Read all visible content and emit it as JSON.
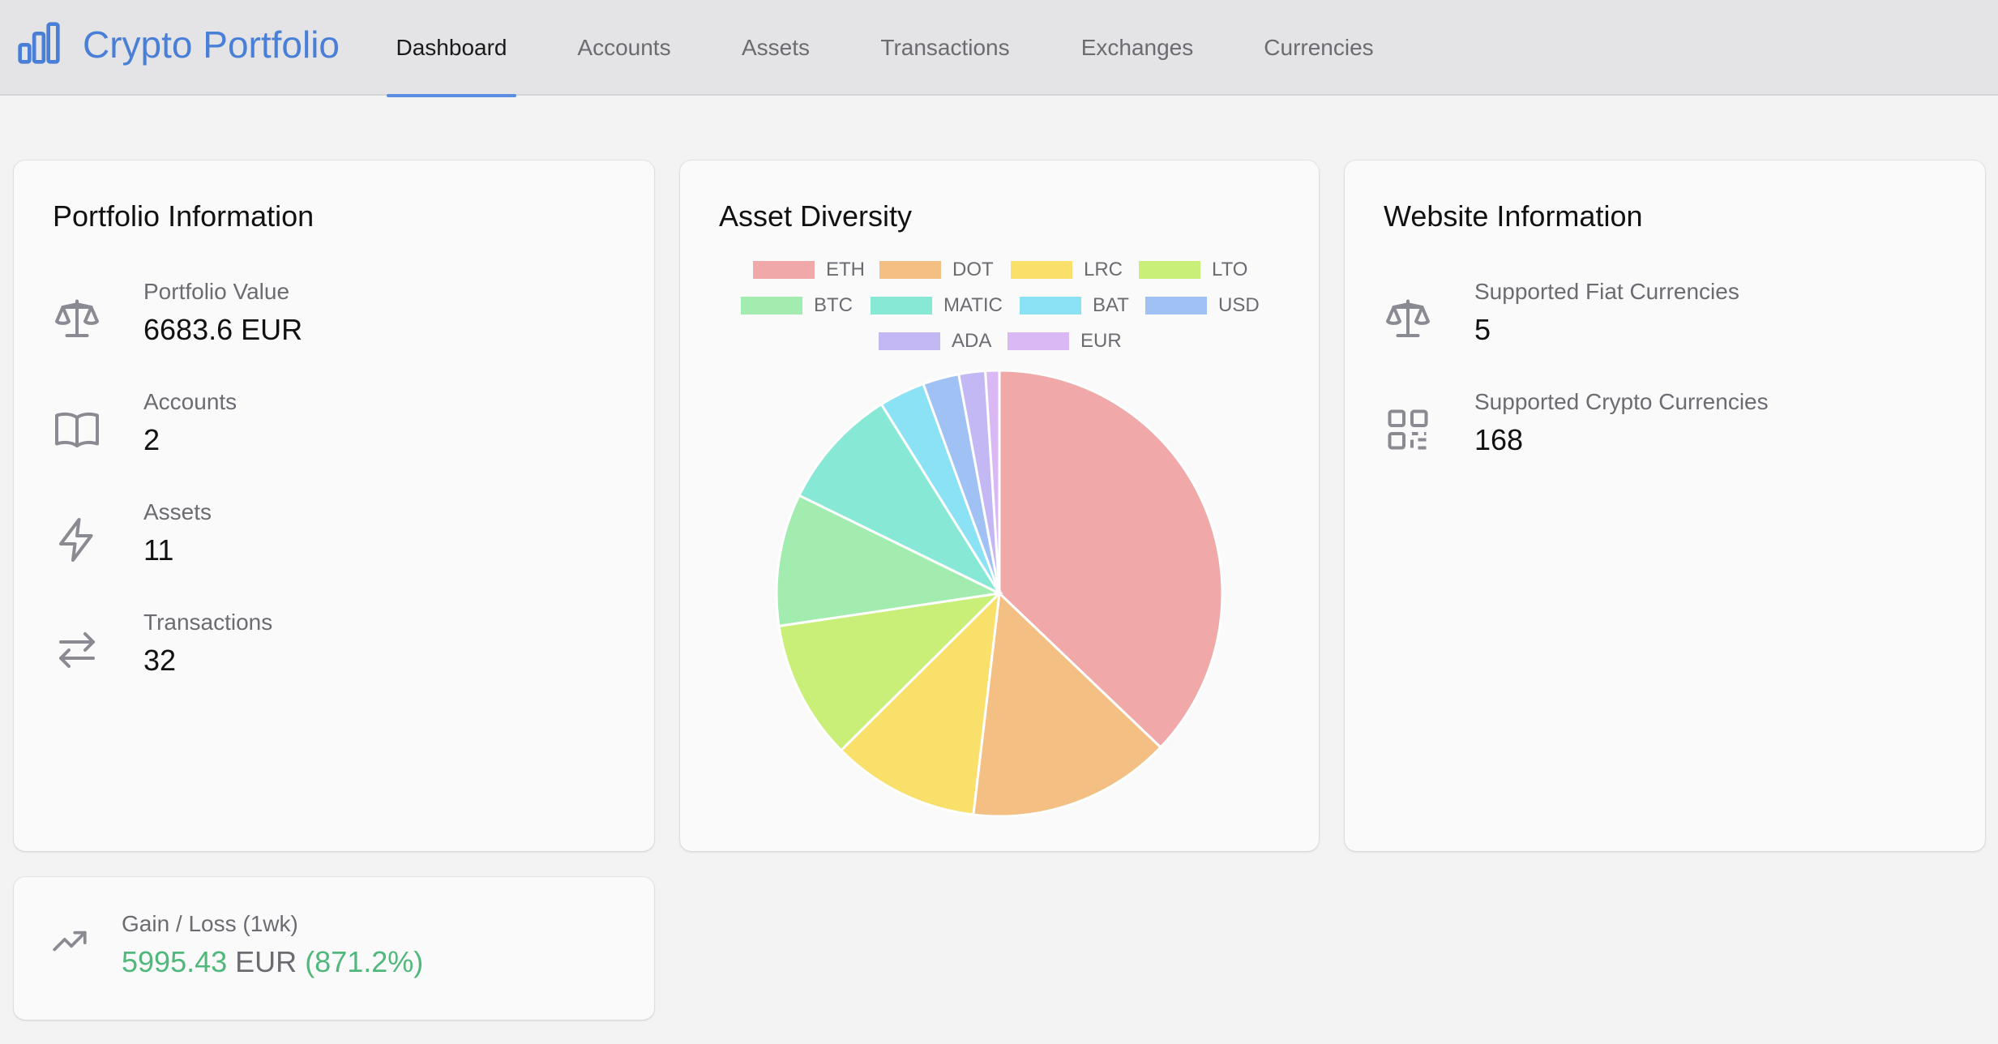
{
  "app": {
    "title": "Crypto Portfolio",
    "brand_color": "#4a7fd8",
    "logo_icon": "bar-chart-icon"
  },
  "nav": {
    "tabs": [
      {
        "label": "Dashboard",
        "active": true
      },
      {
        "label": "Accounts",
        "active": false
      },
      {
        "label": "Assets",
        "active": false
      },
      {
        "label": "Transactions",
        "active": false
      },
      {
        "label": "Exchanges",
        "active": false
      },
      {
        "label": "Currencies",
        "active": false
      }
    ]
  },
  "portfolio": {
    "title": "Portfolio Information",
    "stats": [
      {
        "icon": "scale-icon",
        "label": "Portfolio Value",
        "value": "6683.6 EUR"
      },
      {
        "icon": "book-icon",
        "label": "Accounts",
        "value": "2"
      },
      {
        "icon": "lightning-icon",
        "label": "Assets",
        "value": "11"
      },
      {
        "icon": "arrows-exchange-icon",
        "label": "Transactions",
        "value": "32"
      }
    ]
  },
  "diversity": {
    "title": "Asset Diversity"
  },
  "website": {
    "title": "Website Information",
    "stats": [
      {
        "icon": "scale-icon",
        "label": "Supported Fiat Currencies",
        "value": "5"
      },
      {
        "icon": "qr-code-icon",
        "label": "Supported Crypto Currencies",
        "value": "168"
      }
    ]
  },
  "gain": {
    "icon": "trending-up-icon",
    "label": "Gain / Loss (1wk)",
    "amount": "5995.43",
    "currency": "EUR",
    "percent": "(871.2%)",
    "color": "#4fb87a"
  },
  "chart_data": {
    "type": "pie",
    "title": "Asset Diversity",
    "legend_position": "top",
    "categories": [
      "ETH",
      "DOT",
      "LRC",
      "LTO",
      "BTC",
      "MATIC",
      "BAT",
      "USD",
      "ADA",
      "EUR"
    ],
    "values": [
      36.8,
      14.6,
      10.6,
      10.0,
      9.5,
      8.8,
      3.3,
      2.6,
      1.9,
      1.0
    ],
    "colors": [
      "#f0a8a8",
      "#f3bf82",
      "#f8e06a",
      "#c9ef78",
      "#a2ecb0",
      "#88e8d6",
      "#8ae2f4",
      "#9fc1f3",
      "#c4b8f4",
      "#d9b8f4"
    ]
  }
}
